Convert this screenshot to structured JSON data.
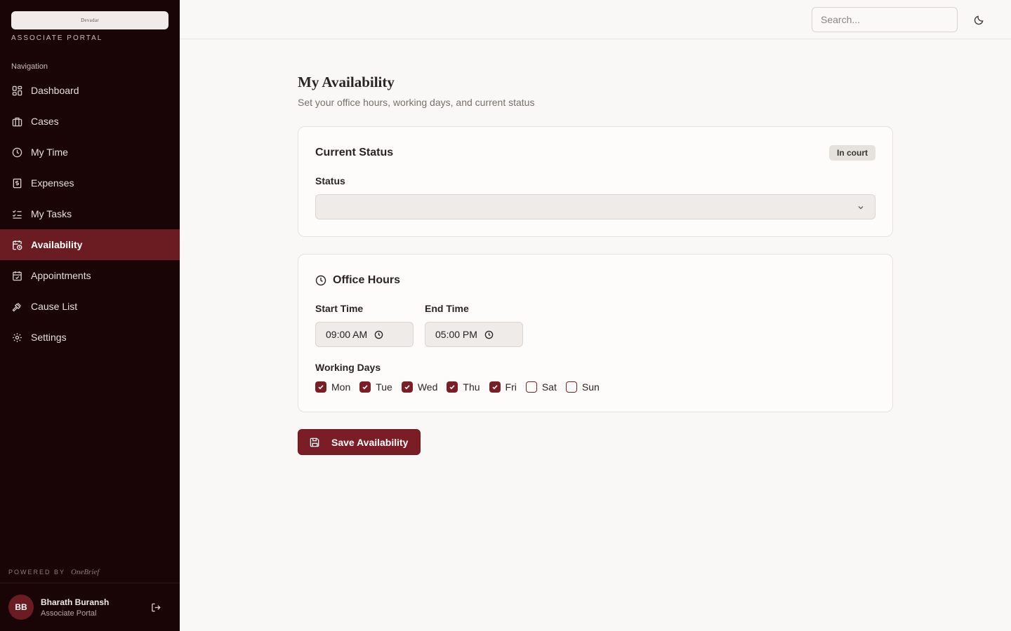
{
  "sidebar": {
    "logo_text": "Devadar",
    "portal_label": "ASSOCIATE PORTAL",
    "nav_heading": "Navigation",
    "items": [
      {
        "label": "Dashboard",
        "icon": "dashboard-icon"
      },
      {
        "label": "Cases",
        "icon": "briefcase-icon"
      },
      {
        "label": "My Time",
        "icon": "clock-icon"
      },
      {
        "label": "Expenses",
        "icon": "receipt-icon"
      },
      {
        "label": "My Tasks",
        "icon": "checklist-icon"
      },
      {
        "label": "Availability",
        "icon": "calendar-clock-icon",
        "active": true
      },
      {
        "label": "Appointments",
        "icon": "calendar-check-icon"
      },
      {
        "label": "Cause List",
        "icon": "gavel-icon"
      },
      {
        "label": "Settings",
        "icon": "gear-icon"
      }
    ],
    "powered_by": "POWERED BY",
    "powered_brand": "OneBrief",
    "user": {
      "initials": "BB",
      "name": "Bharath Buransh",
      "role": "Associate Portal"
    }
  },
  "topbar": {
    "search_placeholder": "Search...",
    "theme_icon": "moon-icon"
  },
  "page": {
    "title": "My Availability",
    "subtitle": "Set your office hours, working days, and current status"
  },
  "status_card": {
    "title": "Current Status",
    "badge": "In court",
    "status_label": "Status",
    "status_value": ""
  },
  "hours_card": {
    "title": "Office Hours",
    "start_label": "Start Time",
    "start_value": "09:00 AM",
    "end_label": "End Time",
    "end_value": "05:00 PM",
    "days_label": "Working Days",
    "days": [
      {
        "label": "Mon",
        "checked": true
      },
      {
        "label": "Tue",
        "checked": true
      },
      {
        "label": "Wed",
        "checked": true
      },
      {
        "label": "Thu",
        "checked": true
      },
      {
        "label": "Fri",
        "checked": true
      },
      {
        "label": "Sat",
        "checked": false
      },
      {
        "label": "Sun",
        "checked": false
      }
    ]
  },
  "save_button": "Save Availability",
  "colors": {
    "accent": "#7b1d24",
    "sidebar_bg": "#1a0506",
    "active_nav": "#6b1c22"
  }
}
